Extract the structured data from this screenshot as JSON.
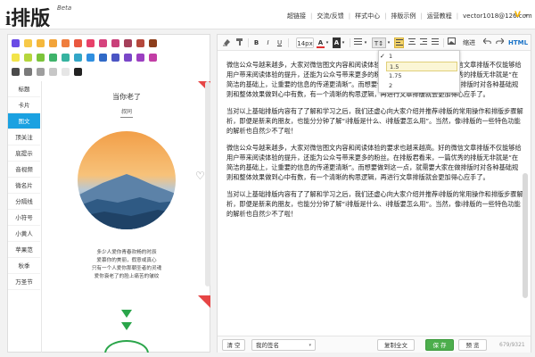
{
  "header": {
    "logo_text": "i排版",
    "logo_badge": "Beta",
    "nav": [
      "超链接",
      "交流/反馈",
      "样式中心",
      "排版示例",
      "运营教程"
    ],
    "user_email": "vector1018@126.com",
    "user_badge": "V",
    "user_caret": "▾"
  },
  "palette": {
    "colors": [
      "#6a4be5",
      "#f7c948",
      "#f5b83c",
      "#f2a43a",
      "#ef7d3d",
      "#e9573f",
      "#e8416a",
      "#d6437e",
      "#c9407a",
      "#a5405a",
      "#b5483c",
      "#8d3e1b",
      "#f2e44a",
      "#b5d63d",
      "#7cc43a",
      "#3eb36a",
      "#36b3a0",
      "#33a6c7",
      "#2f8fe0",
      "#3069c7",
      "#4b55c4",
      "#7a47c8",
      "#9c3fc1",
      "#c23da5",
      "#4a4a4a",
      "#7a7a7a",
      "#9e9e9e",
      "#c7c7c7",
      "#e6e6e6",
      "#222222"
    ]
  },
  "categories": [
    "标题",
    "卡片",
    "图文",
    "顶关注",
    "底提示",
    "音视频",
    "微名片",
    "分隔线",
    "小符号",
    "小黄人",
    "苹果范",
    "秋季",
    "万圣节"
  ],
  "active_category_index": 2,
  "template": {
    "title": "当你老了",
    "subtitle": "叔同",
    "poem": [
      "多少人爱你青春欢畅的时辰",
      "爱慕你的美丽，假意或真心",
      "只有一个人爱你那朝圣者的灵魂",
      "爱你衰老了的脸上痛苦的皱纹"
    ],
    "heart_icon": "♡"
  },
  "toolbar": {
    "font_size": "14px",
    "text_color_icon": "A",
    "bg_color_icon": "A",
    "bold": "B",
    "italic": "I",
    "underline": "U",
    "line_height_icon": "T↕",
    "indent_label": "缩进",
    "html_label": "HTML",
    "caret": "▾"
  },
  "line_height_dropdown": {
    "options": [
      "1",
      "1.5",
      "1.75",
      "2"
    ],
    "checked_index": 0,
    "highlighted_index": 1,
    "check_mark": "✓"
  },
  "editor": {
    "paragraphs": [
      "微信公众号越来越多，大家对微信图文内容和阅读体验的要求也越来越高。好的微信文章排版不仅能够给用户带来阅读体验的提升，还能为公众号带来更多的粉丝。在排版君看来，一篇优秀的排版无非就是“在简洁的基础上，让重要的信息的传递更清晰”。而想要做到这一点，就需要大家在做排版时对各种基础规则和整体效果做到心中有数，有一个清晰的构思逻辑，再进行文章排版就会更加得心应手了。",
      "当对以上基础排版内容有了了解和学习之后，我们还虚心向大家介绍并推荐i排版的常用操作和排版步骤解析，即便是新来的朋友，也能分分钟了解“i排版是什么、i排版要怎么用”。当然，像i排版的一些特色功能的解析也自然少不了啦！",
      "微信公众号越来越多，大家对微信图文内容和阅读体验的要求也越来越高。好的微信文章排版不仅能够给用户带来阅读体验的提升，还能为公众号带来更多的粉丝。在排版君看来，一篇优秀的排版无非就是“在简洁的基础上，让重要的信息的传递更清晰”。而想要做到这一点，就需要大家在做排版时对各种基础规则和整体效果做到心中有数，有一个清晰的构思逻辑，再进行文章排版就会更加得心应手了。",
      "当对以上基础排版内容有了了解和学习之后，我们还虚心向大家介绍并推荐i排版的常用操作和排版步骤解析，即便是新来的朋友，也能分分钟了解“i排版是什么、i排版要怎么用”。当然，像i排版的一些特色功能的解析也自然少不了啦！"
    ]
  },
  "footer": {
    "clear_label": "清 空",
    "signature_label": "我的签名",
    "copy_label": "复制全文",
    "save_label": "保 存",
    "preview_label": "预 览",
    "counter": "679/9321"
  },
  "colors": {
    "accent_blue": "#1aa1e1",
    "save_green": "#4cae4c",
    "arrow_green": "#2aa54a",
    "corner_red": "#e64545"
  }
}
